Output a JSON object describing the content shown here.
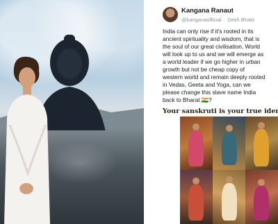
{
  "tweet": {
    "author_name": "Kangana Ranaut",
    "author_handle": "@kanganaofficial",
    "author_tagline": "Desh Bhakt",
    "body_lines": [
      "India can only rise if it's rooted in its",
      "ancient spirituality and wisdom, that is",
      "the soul of our great civilisation. World",
      "will look up to us and we will emerge as",
      "a world leader if we go higher in urban",
      "growth but not be cheap copy of",
      "western world and remain deeply rooted",
      "in Vedas, Geeta and Yoga, can we",
      "please change this slave name India",
      "back to Bharat 🇮🇳?"
    ],
    "image_caption": "Your sanskruti is your true identi"
  }
}
